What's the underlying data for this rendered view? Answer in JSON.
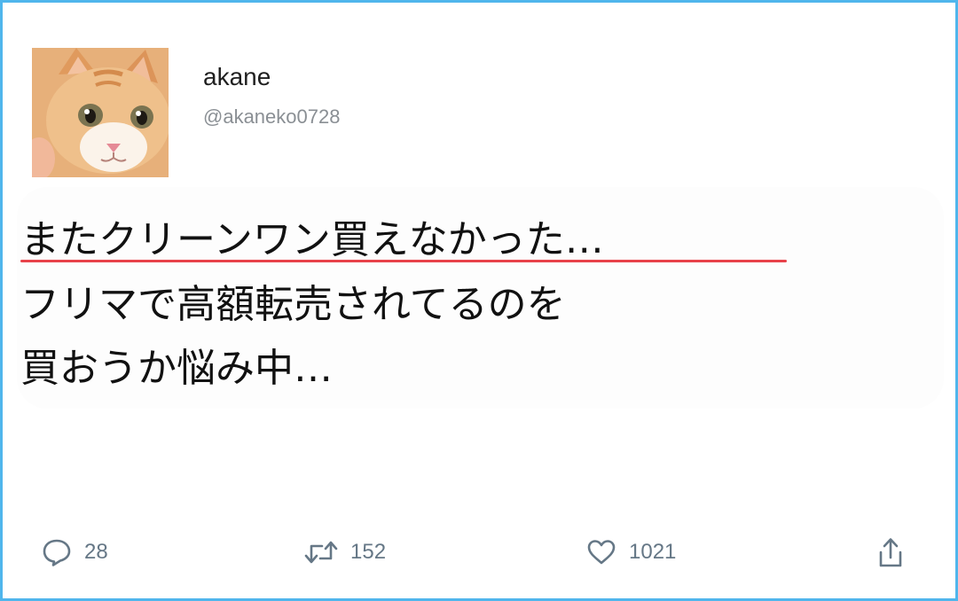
{
  "user": {
    "display_name": "akane",
    "handle": "@akaneko0728"
  },
  "tweet": {
    "lines": [
      "またクリーンワン買えなかった…",
      "フリマで高額転売されてるのを",
      "買おうか悩み中…"
    ],
    "highlight_color": "#e8424a"
  },
  "actions": {
    "reply": {
      "icon": "reply-icon",
      "count": "28"
    },
    "retweet": {
      "icon": "retweet-icon",
      "count": "152"
    },
    "like": {
      "icon": "heart-icon",
      "count": "1021"
    },
    "share": {
      "icon": "share-icon"
    }
  },
  "colors": {
    "border": "#4fb6ec",
    "icon": "#657786"
  }
}
